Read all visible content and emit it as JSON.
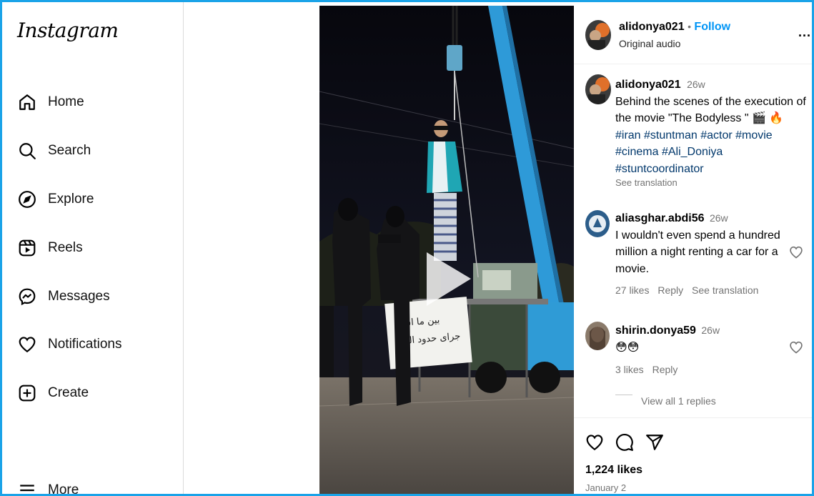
{
  "app": {
    "logo": "Instagram"
  },
  "nav": [
    {
      "label": "Home",
      "icon": "home-icon"
    },
    {
      "label": "Search",
      "icon": "search-icon"
    },
    {
      "label": "Explore",
      "icon": "compass-icon"
    },
    {
      "label": "Reels",
      "icon": "reels-icon"
    },
    {
      "label": "Messages",
      "icon": "messenger-icon"
    },
    {
      "label": "Notifications",
      "icon": "heart-icon"
    },
    {
      "label": "Create",
      "icon": "plus-square-icon"
    },
    {
      "label": "More",
      "icon": "menu-icon"
    }
  ],
  "video": {
    "sign_line1": "بین ما اسم",
    "sign_line2": "جرای حدود الهی"
  },
  "post": {
    "author": "alidonya021",
    "dot": "•",
    "follow": "Follow",
    "audio": "Original audio",
    "more": "...",
    "caption": {
      "username": "alidonya021",
      "time": "26w",
      "text_line1": "Behind the scenes of the execution of",
      "text_line2": "the movie \"The Bodyless \" 🎬 🔥",
      "tags_line1": [
        "#iran",
        "#stuntman",
        "#actor",
        "#movie"
      ],
      "tags_line2": [
        "#cinema",
        "#Ali_Doniya"
      ],
      "tags_line3": [
        "#stuntcoordinator"
      ],
      "see_translation": "See translation"
    },
    "comments": [
      {
        "username": "aliasghar.abdi56",
        "time": "26w",
        "line1": "I wouldn't even spend a hundred",
        "line2": "million a night renting a car for a",
        "line3": "movie.",
        "likes": "27 likes",
        "reply": "Reply",
        "translate": "See translation"
      },
      {
        "username": "shirin.donya59",
        "time": "26w",
        "line1": "😳😳",
        "likes": "3 likes",
        "reply": "Reply",
        "view_replies": "View all 1 replies"
      }
    ],
    "likes": "1,224 likes",
    "date": "January 2"
  },
  "colors": {
    "accent": "#0095f6",
    "tag": "#00376b",
    "muted": "#737373",
    "frame": "#1aa3e8"
  }
}
